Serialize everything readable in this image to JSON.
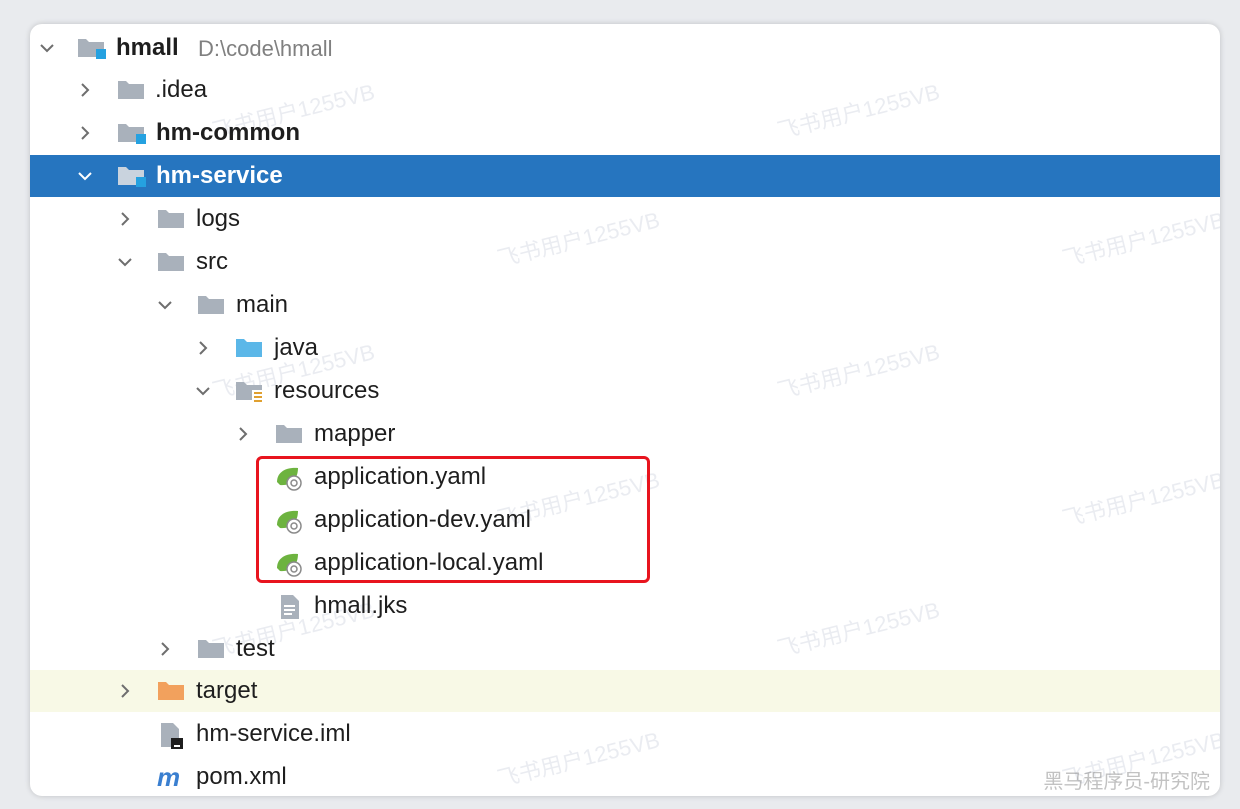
{
  "tree": {
    "root": {
      "name": "hmall",
      "path": "D:\\code\\hmall"
    },
    "idea": ".idea",
    "hm_common": "hm-common",
    "hm_service": "hm-service",
    "logs": "logs",
    "src": "src",
    "main": "main",
    "java": "java",
    "resources": "resources",
    "mapper": "mapper",
    "app_yaml": "application.yaml",
    "app_dev_yaml": "application-dev.yaml",
    "app_local_yaml": "application-local.yaml",
    "hmall_jks": "hmall.jks",
    "test": "test",
    "target": "target",
    "iml": "hm-service.iml",
    "pom": "pom.xml"
  },
  "watermark": "飞书用户1255VB",
  "corner_mark": "黑马程序员-研究院",
  "colors": {
    "selection": "#2675bf",
    "excluded_row": "#f8f9e6",
    "highlight_border": "#e8141e",
    "folder": "#a9b1bb",
    "source_folder": "#5bb7e8",
    "excluded_folder": "#f2a15d",
    "module_badge": "#25a1e0",
    "spring_leaf": "#6db33f"
  },
  "icons": {
    "module": "module-folder-icon",
    "folder": "folder-icon",
    "source": "source-folder-icon",
    "resources": "resources-folder-icon",
    "excluded": "excluded-folder-icon",
    "spring": "spring-config-icon",
    "text_file": "text-file-icon",
    "iml": "iml-file-icon",
    "maven": "maven-icon"
  }
}
